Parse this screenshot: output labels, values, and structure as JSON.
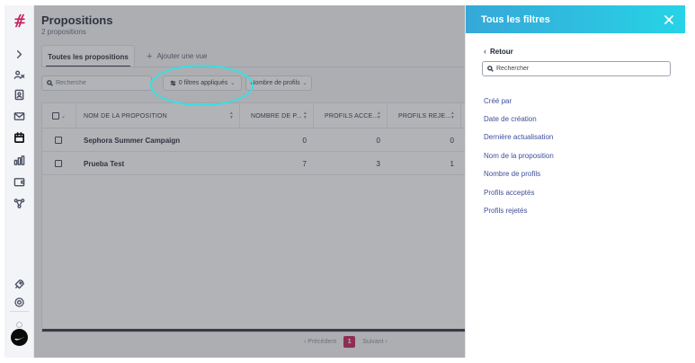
{
  "page": {
    "title": "Propositions",
    "subtitle": "2 propositions"
  },
  "tabs": {
    "active_label": "Toutes les propositions",
    "add_view_label": "Ajouter une vue"
  },
  "toolbar": {
    "search_placeholder": "Recherche",
    "filters_button_label": "0 filtres appliqués",
    "profiles_filter_label": "Nombre de profils"
  },
  "table": {
    "columns": [
      {
        "label": "NOM DE LA PROPOSITION"
      },
      {
        "label": "NOMBRE DE P..."
      },
      {
        "label": "PROFILS ACCE..."
      },
      {
        "label": "PROFILS REJE..."
      }
    ],
    "rows": [
      {
        "name": "Sephora Summer Campaign",
        "profiles": "0",
        "accepted": "0",
        "rejected": "0"
      },
      {
        "name": "Prueba Test",
        "profiles": "7",
        "accepted": "3",
        "rejected": "1"
      }
    ]
  },
  "pagination": {
    "prev_label": "Précédent",
    "current_page": "1",
    "next_label": "Suivant"
  },
  "filter_panel": {
    "title": "Tous les filtres",
    "back_label": "Retour",
    "search_placeholder": "Rechercher",
    "fields": [
      "Créé par",
      "Date de création",
      "Dernière actualisation",
      "Nom de la proposition",
      "Nombre de profils",
      "Profils acceptés",
      "Profils rejetés"
    ]
  },
  "sidebar": {
    "icons": [
      "expand-chevron-icon",
      "people-icon",
      "contacts-icon",
      "mail-icon",
      "proposals-icon",
      "analytics-icon",
      "wallet-icon",
      "network-icon",
      "rocket-icon",
      "settings-icon"
    ]
  },
  "colors": {
    "brand": "#c21d54",
    "panel_header_start": "#35a8d8",
    "panel_header_end": "#27d3e6",
    "highlight_ring": "#35e0e6",
    "filter_link": "#3f4e9a"
  }
}
